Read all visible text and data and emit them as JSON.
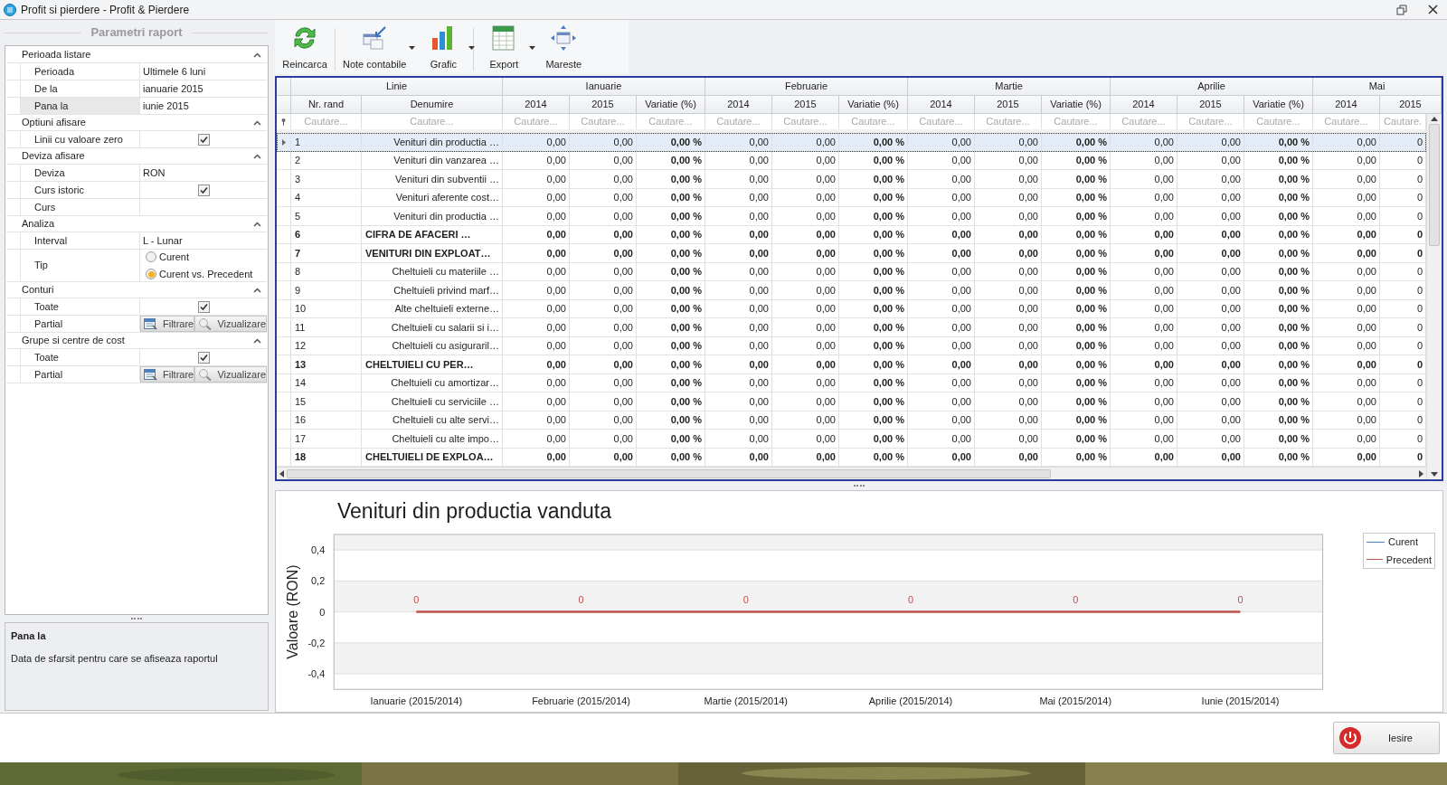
{
  "window": {
    "title": "Profit si pierdere - Profit & Pierdere"
  },
  "params": {
    "title": "Parametri raport",
    "sections": [
      {
        "label": "Perioada listare",
        "expanded": true,
        "rows": [
          {
            "kind": "text",
            "label": "Perioada",
            "value": "Ultimele 6 luni",
            "selected": false
          },
          {
            "kind": "text",
            "label": "De la",
            "value": "ianuarie 2015",
            "selected": false
          },
          {
            "kind": "text",
            "label": "Pana la",
            "value": "iunie 2015",
            "selected": true
          }
        ]
      },
      {
        "label": "Optiuni afisare",
        "expanded": true,
        "rows": [
          {
            "kind": "checkbox",
            "label": "Linii cu valoare zero",
            "checked": true,
            "selected": false
          }
        ]
      },
      {
        "label": "Deviza afisare",
        "expanded": true,
        "rows": [
          {
            "kind": "text",
            "label": "Deviza",
            "value": "RON",
            "selected": false
          },
          {
            "kind": "checkbox",
            "label": "Curs istoric",
            "checked": true,
            "selected": false
          },
          {
            "kind": "text",
            "label": "Curs",
            "selected": false
          }
        ]
      },
      {
        "label": "Analiza",
        "expanded": true,
        "rows": [
          {
            "kind": "text",
            "label": "Interval",
            "value": "L - Lunar",
            "selected": false
          },
          {
            "kind": "radio",
            "label": "Tip",
            "options": [
              {
                "label": "Curent",
                "selected": false
              },
              {
                "label": "Curent vs. Precedent",
                "selected": true
              }
            ],
            "selected": false
          }
        ]
      },
      {
        "label": "Conturi",
        "expanded": true,
        "rows": [
          {
            "kind": "checkbox",
            "label": "Toate",
            "checked": true,
            "selected": false
          },
          {
            "kind": "buttons",
            "label": "Partial",
            "buttons": [
              "Filtrare",
              "Vizualizare"
            ],
            "selected": false
          }
        ]
      },
      {
        "label": "Grupe si centre de cost",
        "expanded": true,
        "rows": [
          {
            "kind": "checkbox",
            "label": "Toate",
            "checked": true,
            "selected": false
          },
          {
            "kind": "buttons",
            "label": "Partial",
            "buttons": [
              "Filtrare",
              "Vizualizare"
            ],
            "selected": false
          }
        ]
      }
    ]
  },
  "description": {
    "title": "Pana la",
    "text": "Data de sfarsit pentru care se afiseaza raportul"
  },
  "toolbar": [
    {
      "label": "Reincarca",
      "dropdown": false
    },
    {
      "label": "Note contabile",
      "dropdown": true
    },
    {
      "label": "Grafic",
      "dropdown": true
    },
    {
      "label": "Export",
      "dropdown": true
    },
    {
      "label": "Mareste",
      "dropdown": false
    }
  ],
  "grid": {
    "groups": [
      {
        "label": "Linie",
        "columns": [
          {
            "kind": "number",
            "label": "Nr. rand",
            "placeholder": "Cautare..."
          },
          {
            "kind": "name",
            "label": "Denumire",
            "placeholder": "Cautare..."
          }
        ]
      },
      {
        "label": "Ianuarie",
        "columns": [
          {
            "kind": "amount",
            "label": "2014",
            "placeholder": "Cautare..."
          },
          {
            "kind": "amount",
            "label": "2015",
            "placeholder": "Cautare..."
          },
          {
            "kind": "percent",
            "label": "Variatie (%)",
            "placeholder": "Cautare..."
          }
        ]
      },
      {
        "label": "Februarie",
        "columns": [
          {
            "kind": "amount",
            "label": "2014",
            "placeholder": "Cautare..."
          },
          {
            "kind": "amount",
            "label": "2015",
            "placeholder": "Cautare..."
          },
          {
            "kind": "percent",
            "label": "Variatie (%)",
            "placeholder": "Cautare..."
          }
        ]
      },
      {
        "label": "Martie",
        "columns": [
          {
            "kind": "amount",
            "label": "2014",
            "placeholder": "Cautare..."
          },
          {
            "kind": "amount",
            "label": "2015",
            "placeholder": "Cautare..."
          },
          {
            "kind": "percent",
            "label": "Variatie (%)",
            "placeholder": "Cautare..."
          }
        ]
      },
      {
        "label": "Aprilie",
        "columns": [
          {
            "kind": "amount",
            "label": "2014",
            "placeholder": "Cautare..."
          },
          {
            "kind": "amount",
            "label": "2015",
            "placeholder": "Cautare..."
          },
          {
            "kind": "percent",
            "label": "Variatie (%)",
            "placeholder": "Cautare..."
          }
        ]
      },
      {
        "label": "Mai",
        "columns": [
          {
            "kind": "amount",
            "label": "2014",
            "placeholder": "Cautare..."
          },
          {
            "kind": "cut",
            "label": "2015",
            "placeholder": "Cautare."
          }
        ]
      }
    ],
    "rows": [
      {
        "selected": true,
        "bold": false,
        "cells": [
          "1",
          "Venituri din productia …",
          "0,00",
          "0,00",
          "0,00 %",
          "0,00",
          "0,00",
          "0,00 %",
          "0,00",
          "0,00",
          "0,00 %",
          "0,00",
          "0,00",
          "0,00 %",
          "0,00",
          "0"
        ]
      },
      {
        "selected": false,
        "bold": false,
        "cells": [
          "2",
          "Venituri din vanzarea …",
          "0,00",
          "0,00",
          "0,00 %",
          "0,00",
          "0,00",
          "0,00 %",
          "0,00",
          "0,00",
          "0,00 %",
          "0,00",
          "0,00",
          "0,00 %",
          "0,00",
          "0"
        ]
      },
      {
        "selected": false,
        "bold": false,
        "cells": [
          "3",
          "Venituri din subventii …",
          "0,00",
          "0,00",
          "0,00 %",
          "0,00",
          "0,00",
          "0,00 %",
          "0,00",
          "0,00",
          "0,00 %",
          "0,00",
          "0,00",
          "0,00 %",
          "0,00",
          "0"
        ]
      },
      {
        "selected": false,
        "bold": false,
        "cells": [
          "4",
          "Venituri aferente cost…",
          "0,00",
          "0,00",
          "0,00 %",
          "0,00",
          "0,00",
          "0,00 %",
          "0,00",
          "0,00",
          "0,00 %",
          "0,00",
          "0,00",
          "0,00 %",
          "0,00",
          "0"
        ]
      },
      {
        "selected": false,
        "bold": false,
        "cells": [
          "5",
          "Venituri din productia …",
          "0,00",
          "0,00",
          "0,00 %",
          "0,00",
          "0,00",
          "0,00 %",
          "0,00",
          "0,00",
          "0,00 %",
          "0,00",
          "0,00",
          "0,00 %",
          "0,00",
          "0"
        ]
      },
      {
        "selected": false,
        "bold": true,
        "cells": [
          "6",
          "CIFRA DE AFACERI …",
          "0,00",
          "0,00",
          "0,00 %",
          "0,00",
          "0,00",
          "0,00 %",
          "0,00",
          "0,00",
          "0,00 %",
          "0,00",
          "0,00",
          "0,00 %",
          "0,00",
          "0"
        ]
      },
      {
        "selected": false,
        "bold": true,
        "cells": [
          "7",
          "VENITURI DIN EXPLOAT…",
          "0,00",
          "0,00",
          "0,00 %",
          "0,00",
          "0,00",
          "0,00 %",
          "0,00",
          "0,00",
          "0,00 %",
          "0,00",
          "0,00",
          "0,00 %",
          "0,00",
          "0"
        ]
      },
      {
        "selected": false,
        "bold": false,
        "cells": [
          "8",
          "Cheltuieli cu materiile …",
          "0,00",
          "0,00",
          "0,00 %",
          "0,00",
          "0,00",
          "0,00 %",
          "0,00",
          "0,00",
          "0,00 %",
          "0,00",
          "0,00",
          "0,00 %",
          "0,00",
          "0"
        ]
      },
      {
        "selected": false,
        "bold": false,
        "cells": [
          "9",
          "Cheltuieli privind marf…",
          "0,00",
          "0,00",
          "0,00 %",
          "0,00",
          "0,00",
          "0,00 %",
          "0,00",
          "0,00",
          "0,00 %",
          "0,00",
          "0,00",
          "0,00 %",
          "0,00",
          "0"
        ]
      },
      {
        "selected": false,
        "bold": false,
        "cells": [
          "10",
          "Alte cheltuieli externe…",
          "0,00",
          "0,00",
          "0,00 %",
          "0,00",
          "0,00",
          "0,00 %",
          "0,00",
          "0,00",
          "0,00 %",
          "0,00",
          "0,00",
          "0,00 %",
          "0,00",
          "0"
        ]
      },
      {
        "selected": false,
        "bold": false,
        "cells": [
          "11",
          "Cheltuieli cu salarii si i…",
          "0,00",
          "0,00",
          "0,00 %",
          "0,00",
          "0,00",
          "0,00 %",
          "0,00",
          "0,00",
          "0,00 %",
          "0,00",
          "0,00",
          "0,00 %",
          "0,00",
          "0"
        ]
      },
      {
        "selected": false,
        "bold": false,
        "cells": [
          "12",
          "Cheltuieli cu asiguraril…",
          "0,00",
          "0,00",
          "0,00 %",
          "0,00",
          "0,00",
          "0,00 %",
          "0,00",
          "0,00",
          "0,00 %",
          "0,00",
          "0,00",
          "0,00 %",
          "0,00",
          "0"
        ]
      },
      {
        "selected": false,
        "bold": true,
        "cells": [
          "13",
          "CHELTUIELI CU PER…",
          "0,00",
          "0,00",
          "0,00 %",
          "0,00",
          "0,00",
          "0,00 %",
          "0,00",
          "0,00",
          "0,00 %",
          "0,00",
          "0,00",
          "0,00 %",
          "0,00",
          "0"
        ]
      },
      {
        "selected": false,
        "bold": false,
        "cells": [
          "14",
          "Cheltuieli cu amortizar…",
          "0,00",
          "0,00",
          "0,00 %",
          "0,00",
          "0,00",
          "0,00 %",
          "0,00",
          "0,00",
          "0,00 %",
          "0,00",
          "0,00",
          "0,00 %",
          "0,00",
          "0"
        ]
      },
      {
        "selected": false,
        "bold": false,
        "cells": [
          "15",
          "Cheltuieli cu serviciile …",
          "0,00",
          "0,00",
          "0,00 %",
          "0,00",
          "0,00",
          "0,00 %",
          "0,00",
          "0,00",
          "0,00 %",
          "0,00",
          "0,00",
          "0,00 %",
          "0,00",
          "0"
        ]
      },
      {
        "selected": false,
        "bold": false,
        "cells": [
          "16",
          "Cheltuieli cu alte servi…",
          "0,00",
          "0,00",
          "0,00 %",
          "0,00",
          "0,00",
          "0,00 %",
          "0,00",
          "0,00",
          "0,00 %",
          "0,00",
          "0,00",
          "0,00 %",
          "0,00",
          "0"
        ]
      },
      {
        "selected": false,
        "bold": false,
        "cells": [
          "17",
          "Cheltuieli cu alte impo…",
          "0,00",
          "0,00",
          "0,00 %",
          "0,00",
          "0,00",
          "0,00 %",
          "0,00",
          "0,00",
          "0,00 %",
          "0,00",
          "0,00",
          "0,00 %",
          "0,00",
          "0"
        ]
      },
      {
        "selected": false,
        "bold": true,
        "cells": [
          "18",
          "CHELTUIELI DE EXPLOA…",
          "0,00",
          "0,00",
          "0,00 %",
          "0,00",
          "0,00",
          "0,00 %",
          "0,00",
          "0,00",
          "0,00 %",
          "0,00",
          "0,00",
          "0,00 %",
          "0,00",
          "0"
        ]
      }
    ]
  },
  "chart": {
    "chart_data": {
      "type": "line",
      "title": "Venituri din productia vanduta",
      "ylabel": "Valoare (RON)",
      "categories": [
        "Ianuarie (2015/2014)",
        "Februarie (2015/2014)",
        "Martie (2015/2014)",
        "Aprilie (2015/2014)",
        "Mai (2015/2014)",
        "Iunie (2015/2014)"
      ],
      "series": [
        {
          "name": "Curent",
          "color": "#4f81bd",
          "values": [
            null,
            null,
            null,
            null,
            null,
            null
          ]
        },
        {
          "name": "Precedent",
          "color": "#c0504d",
          "values": [
            0,
            0,
            0,
            0,
            0,
            0
          ],
          "value_labels": [
            "0",
            "0",
            "0",
            "0",
            "0",
            "0"
          ]
        }
      ],
      "ylim": [
        -0.5,
        0.5
      ],
      "yticks": [
        {
          "value": 0.4,
          "label": "0,4"
        },
        {
          "value": 0.2,
          "label": "0,2"
        },
        {
          "value": 0,
          "label": "0"
        },
        {
          "value": -0.2,
          "label": "-0,2"
        },
        {
          "value": -0.4,
          "label": "-0,4"
        }
      ],
      "grid": true
    }
  },
  "footer": {
    "exit_button": "Iesire"
  }
}
